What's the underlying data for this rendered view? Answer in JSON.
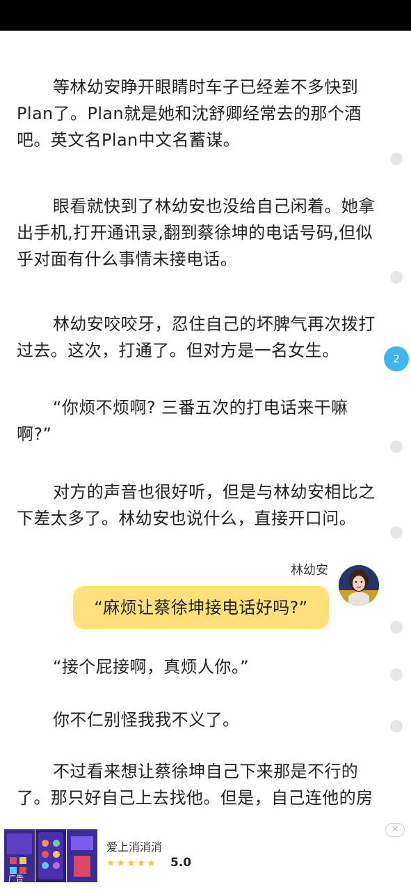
{
  "reader": {
    "paragraphs": [
      "等林幼安睁开眼睛时车子已经差不多快到Plan了。Plan就是她和沈舒卿经常去的那个酒吧。英文名Plan中文名蓄谋。",
      "眼看就快到了林幼安也没给自己闲着。她拿出手机,打开通讯录,翻到蔡徐坤的电话号码,但似乎对面有什么事情未接电话。",
      "林幼安咬咬牙，忍住自己的坏脾气再次拨打过去。这次，打通了。但对方是一名女生。",
      "“你烦不烦啊? 三番五次的打电话来干嘛啊?”",
      "对方的声音也很好听，但是与林幼安相比之下差太多了。林幼安也说什么，直接开口问。",
      "“接个屁接啊，真烦人你。”",
      "你不仁别怪我我不义了。",
      "不过看来想让蔡徐坤自己下来那是不行的了。那只好自己上去找他。但是，自己连他的房"
    ],
    "dialogue": {
      "speaker": "林幼安",
      "text": "“麻烦让蔡徐坤接电话好吗?”"
    },
    "comment_count_badge": "2",
    "colors": {
      "bubble": "#ffe07a",
      "badge": "#3fb4ee"
    }
  },
  "ad": {
    "label": "广告",
    "title": "爱上消消消",
    "stars": "★★★★★",
    "rating": "5.0",
    "close_icon": "close-icon"
  }
}
